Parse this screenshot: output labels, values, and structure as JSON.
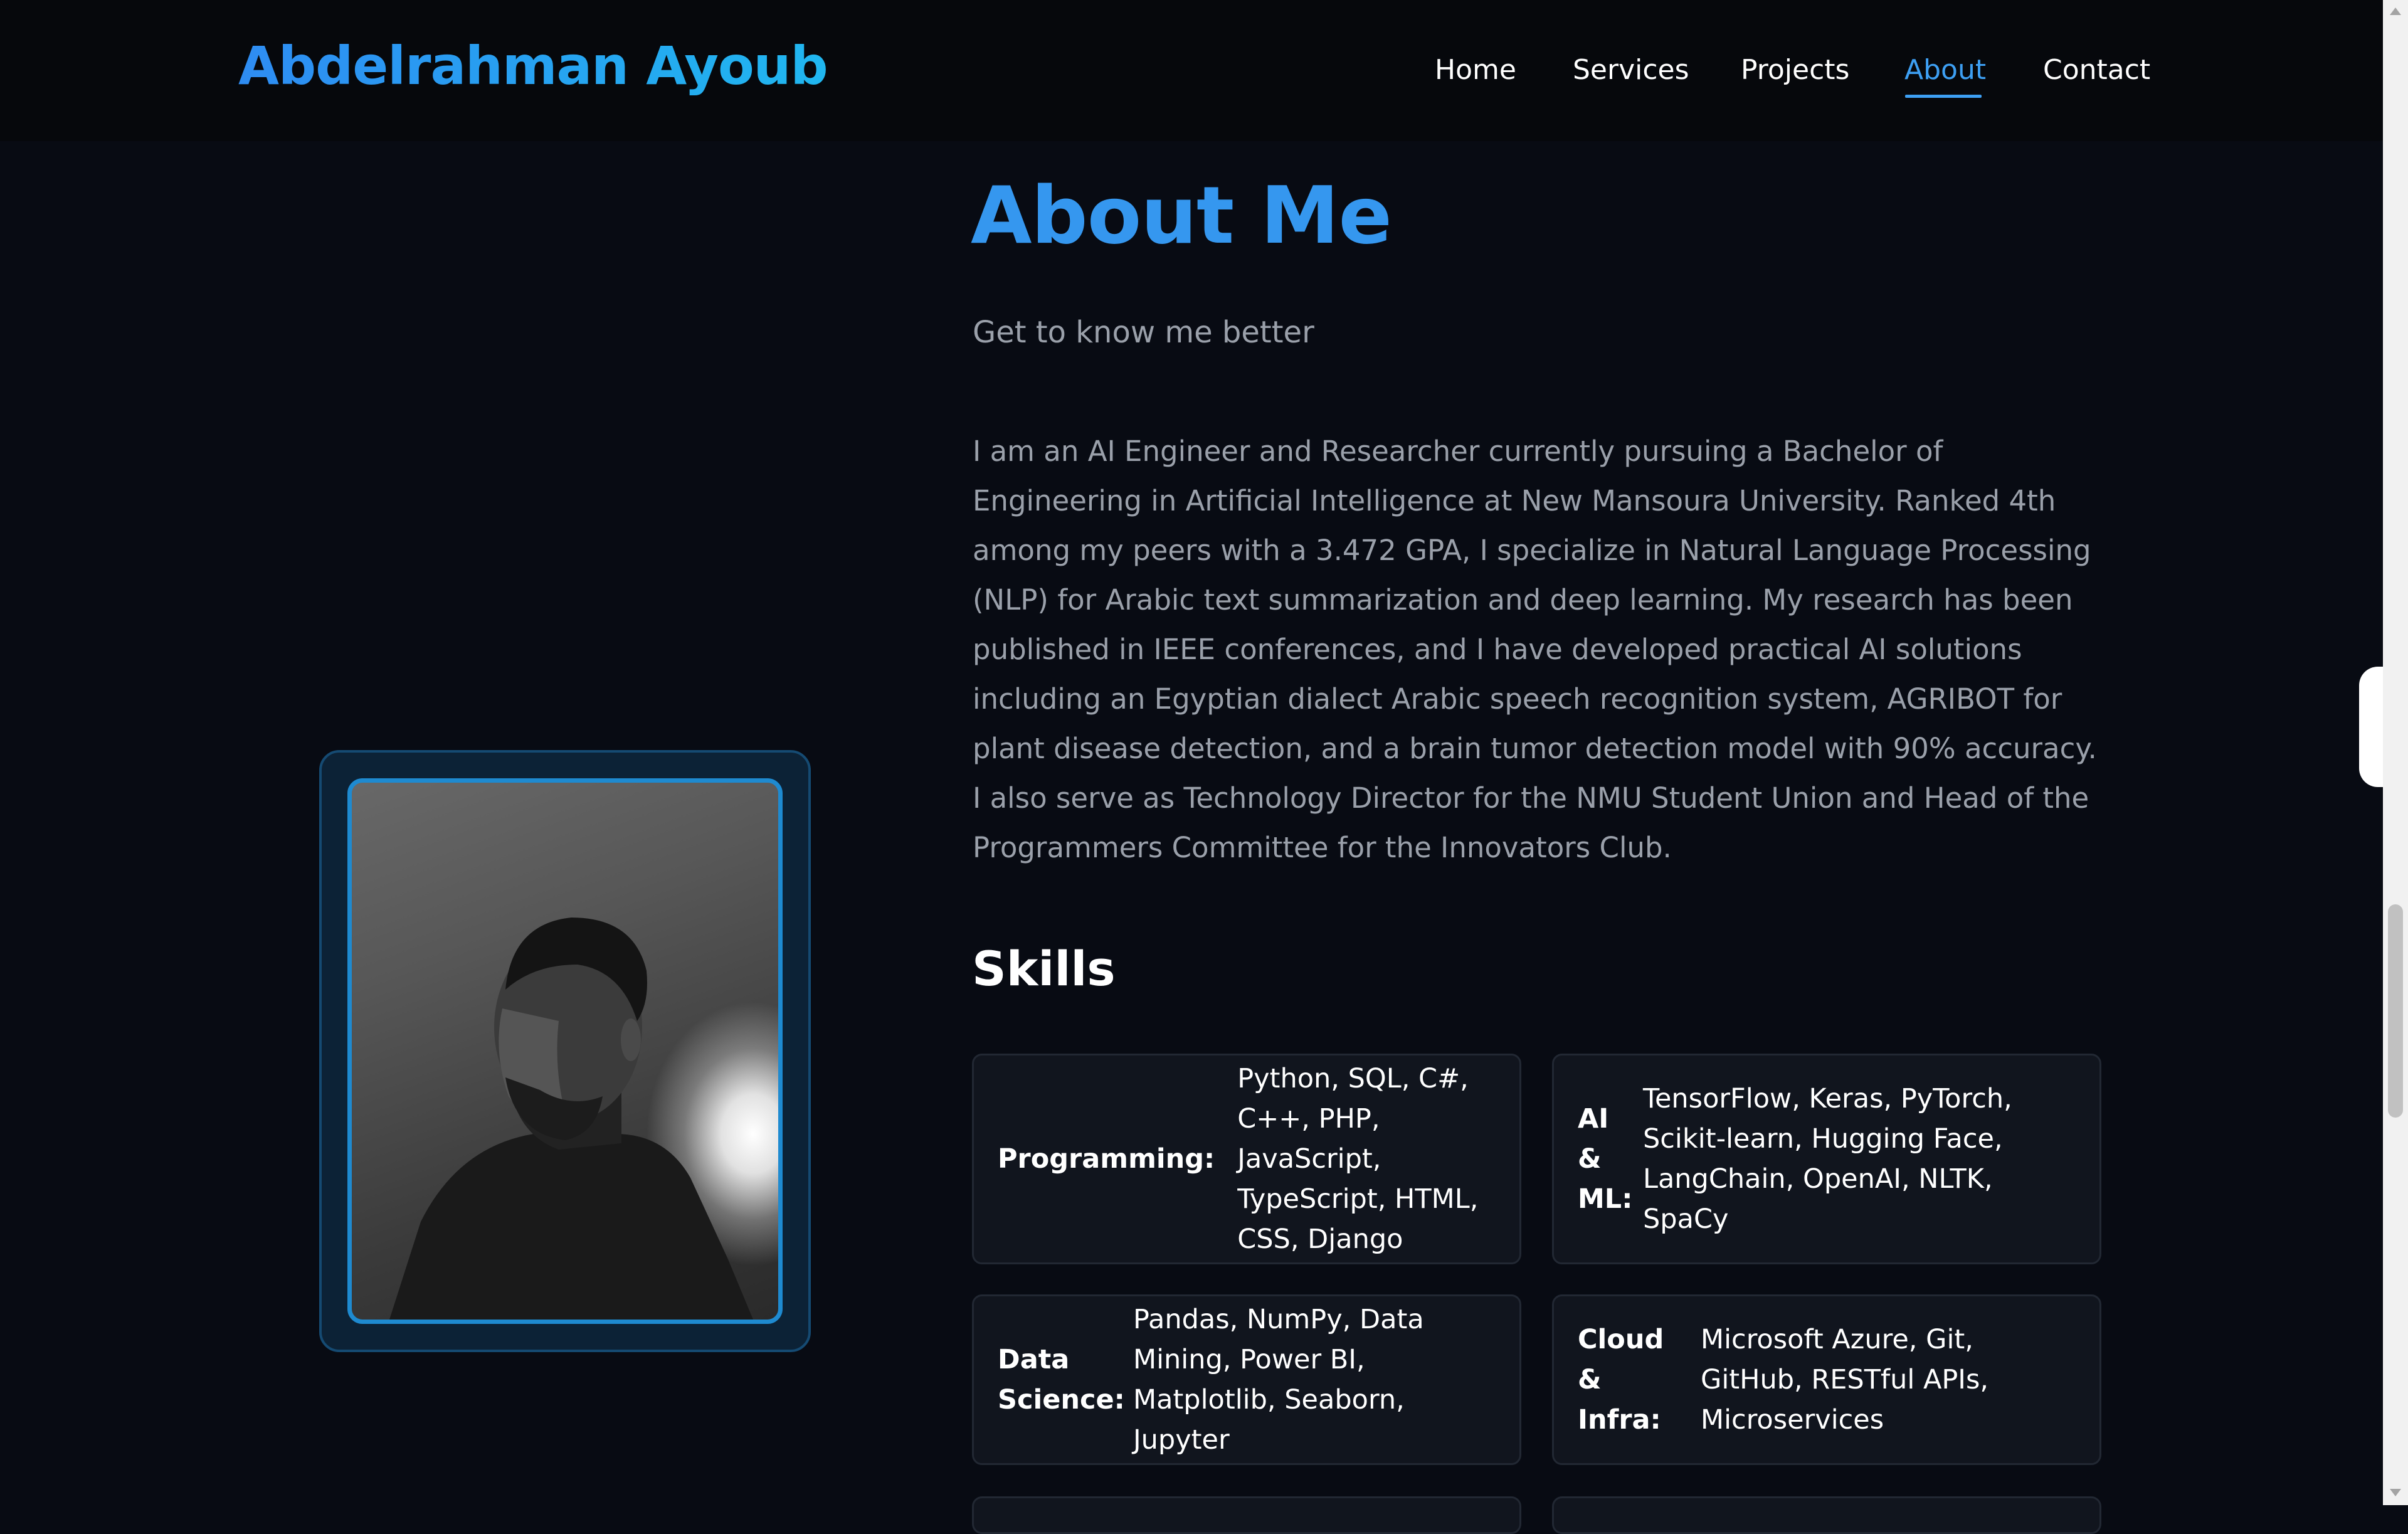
{
  "header": {
    "logo": "Abdelrahman Ayoub",
    "nav": [
      "Home",
      "Services",
      "Projects",
      "About",
      "Contact"
    ],
    "active_nav": "About"
  },
  "about": {
    "title": "About Me",
    "subtitle": "Get to know me better",
    "body": "I am an AI Engineer and Researcher currently pursuing a Bachelor of Engineering in Artificial Intelligence at New Mansoura University. Ranked 4th among my peers with a 3.472 GPA, I specialize in Natural Language Processing (NLP) for Arabic text summarization and deep learning. My research has been published in IEEE conferences, and I have developed practical AI solutions including an Egyptian dialect Arabic speech recognition system, AGRIBOT for plant disease detection, and a brain tumor detection model with 90% accuracy. I also serve as Technology Director for the NMU Student Union and Head of the Programmers Committee for the Innovators Club."
  },
  "skills": {
    "title": "Skills",
    "items": [
      {
        "label": "Programming:",
        "values": "Python, SQL, C#, C++, PHP, JavaScript, TypeScript, HTML, CSS, Django"
      },
      {
        "label": "AI & ML:",
        "values": "TensorFlow, Keras, PyTorch, Scikit-learn, Hugging Face, LangChain, OpenAI, NLTK, SpaCy"
      },
      {
        "label": "Data Science:",
        "values": "Pandas, NumPy, Data Mining, Power BI, Matplotlib, Seaborn, Jupyter"
      },
      {
        "label": "Cloud & Infra:",
        "values": "Microsoft Azure, Git, GitHub, RESTful APIs, Microservices"
      }
    ]
  },
  "colors": {
    "background": "#080b13",
    "accent": "#3597ef",
    "muted_text": "#9aa0aa",
    "card": "#11151e",
    "photo_border": "#1e8ad0"
  }
}
